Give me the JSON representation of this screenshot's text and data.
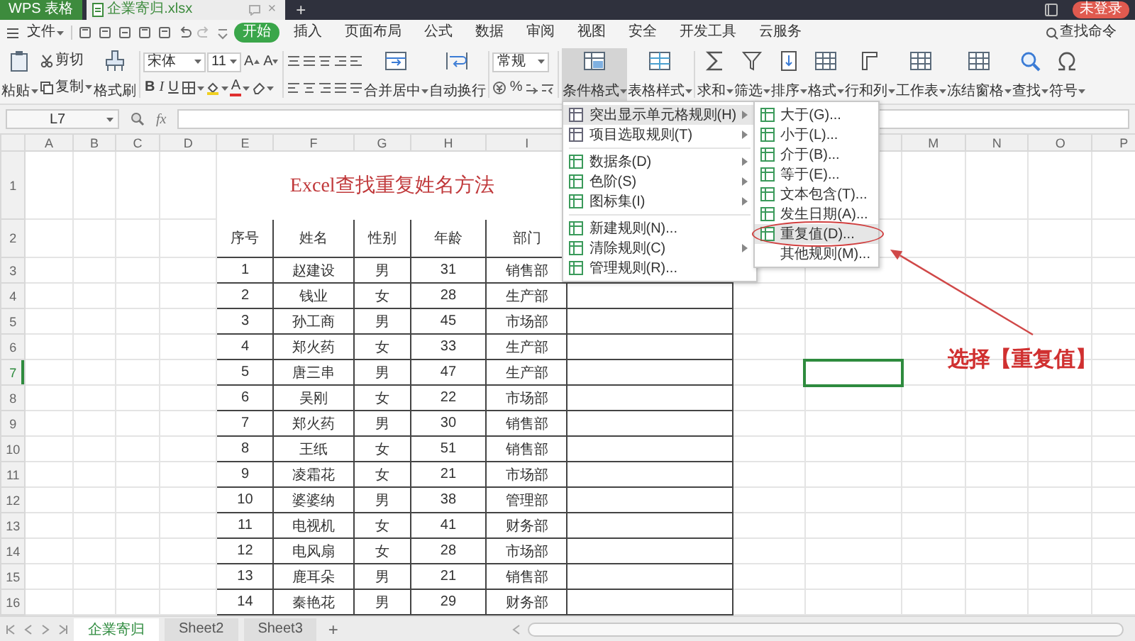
{
  "title_bar": {
    "app": "WPS 表格",
    "file_tab": "企業寄归.xlsx",
    "close": "×",
    "new_tab": "+",
    "account": "未登录"
  },
  "menu_bar": {
    "file": "文件",
    "tabs": [
      {
        "label": "开始",
        "selected": true
      },
      {
        "label": "插入",
        "selected": false
      },
      {
        "label": "页面布局",
        "selected": false
      },
      {
        "label": "公式",
        "selected": false
      },
      {
        "label": "数据",
        "selected": false
      },
      {
        "label": "审阅",
        "selected": false
      },
      {
        "label": "视图",
        "selected": false
      },
      {
        "label": "安全",
        "selected": false
      },
      {
        "label": "开发工具",
        "selected": false
      },
      {
        "label": "云服务",
        "selected": false
      }
    ],
    "search": "查找命令"
  },
  "ribbon": {
    "clipboard": {
      "paste": {
        "label": "粘贴",
        "dropdown": true
      },
      "cut": {
        "label": "剪切"
      },
      "copy": {
        "label": "复制",
        "dropdown": true
      },
      "format_painter": {
        "label": "格式刷"
      }
    },
    "font": {
      "family": "宋体",
      "size": "11",
      "grow": "A",
      "shrink": "A",
      "bold": "B",
      "italic": "I",
      "underline": "U",
      "font_color": "A"
    },
    "alignment": {
      "merge": {
        "label": "合并居中",
        "dropdown": true
      },
      "wrap": {
        "label": "自动换行"
      }
    },
    "number": {
      "format": "常规",
      "percent": "%"
    },
    "buttons": [
      {
        "label": "条件格式",
        "dropdown": true,
        "pressed": true
      },
      {
        "label": "表格样式",
        "dropdown": true,
        "pressed": false
      },
      {
        "label": "求和",
        "dropdown": true,
        "pressed": false
      },
      {
        "label": "筛选",
        "dropdown": true,
        "pressed": false
      },
      {
        "label": "排序",
        "dropdown": true,
        "pressed": false
      },
      {
        "label": "格式",
        "dropdown": true,
        "pressed": false
      },
      {
        "label": "行和列",
        "dropdown": true,
        "pressed": false
      },
      {
        "label": "工作表",
        "dropdown": true,
        "pressed": false
      },
      {
        "label": "冻结窗格",
        "dropdown": true,
        "pressed": false
      },
      {
        "label": "查找",
        "dropdown": true,
        "pressed": false
      },
      {
        "label": "符号",
        "dropdown": true,
        "pressed": false
      }
    ]
  },
  "formula_bar": {
    "name_box": "L7",
    "function_label": "fx"
  },
  "sheet": {
    "columns_left": [
      "A",
      "B",
      "C",
      "D",
      "E",
      "F",
      "G",
      "H",
      "I"
    ],
    "columns_right": [
      "M",
      "N",
      "O",
      "P"
    ],
    "title": "Excel查找重复姓名方法",
    "headers": [
      "序号",
      "姓名",
      "性别",
      "年龄",
      "部门"
    ],
    "rows": [
      {
        "label": "1",
        "selected": false
      },
      {
        "label": "2",
        "selected": false
      },
      {
        "label": "3",
        "selected": false
      },
      {
        "label": "4",
        "selected": false
      },
      {
        "label": "5",
        "selected": false
      },
      {
        "label": "6",
        "selected": false
      },
      {
        "label": "7",
        "selected": true
      },
      {
        "label": "8",
        "selected": false
      },
      {
        "label": "9",
        "selected": false
      },
      {
        "label": "10",
        "selected": false
      },
      {
        "label": "11",
        "selected": false
      },
      {
        "label": "12",
        "selected": false
      },
      {
        "label": "13",
        "selected": false
      },
      {
        "label": "14",
        "selected": false
      },
      {
        "label": "15",
        "selected": false
      },
      {
        "label": "16",
        "selected": false
      }
    ],
    "records": [
      [
        "1",
        "赵建设",
        "男",
        "31",
        "销售部"
      ],
      [
        "2",
        "钱业",
        "女",
        "28",
        "生产部"
      ],
      [
        "3",
        "孙工商",
        "男",
        "45",
        "市场部"
      ],
      [
        "4",
        "郑火药",
        "女",
        "33",
        "生产部"
      ],
      [
        "5",
        "唐三串",
        "男",
        "47",
        "生产部"
      ],
      [
        "6",
        "吴刚",
        "女",
        "22",
        "市场部"
      ],
      [
        "7",
        "郑火药",
        "男",
        "30",
        "销售部"
      ],
      [
        "8",
        "王纸",
        "女",
        "51",
        "销售部"
      ],
      [
        "9",
        "凌霜花",
        "女",
        "21",
        "市场部"
      ],
      [
        "10",
        "婆婆纳",
        "男",
        "38",
        "管理部"
      ],
      [
        "11",
        "电视机",
        "女",
        "41",
        "财务部"
      ],
      [
        "12",
        "电风扇",
        "女",
        "28",
        "市场部"
      ],
      [
        "13",
        "鹿耳朵",
        "男",
        "21",
        "销售部"
      ],
      [
        "14",
        "秦艳花",
        "男",
        "29",
        "财务部"
      ]
    ]
  },
  "sheet_tabs": {
    "tabs": [
      {
        "label": "企業寄归",
        "selected": true
      },
      {
        "label": "Sheet2",
        "selected": false
      },
      {
        "label": "Sheet3",
        "selected": false
      }
    ],
    "add": "+"
  },
  "menu": {
    "groups": [
      {
        "items": [
          {
            "label": "突出显示单元格规则(H)",
            "submenu": true,
            "selected": true
          },
          {
            "label": "项目选取规则(T)",
            "submenu": true,
            "selected": false
          }
        ]
      },
      {
        "items": [
          {
            "label": "数据条(D)",
            "submenu": true,
            "selected": false
          },
          {
            "label": "色阶(S)",
            "submenu": true,
            "selected": false
          },
          {
            "label": "图标集(I)",
            "submenu": true,
            "selected": false
          }
        ]
      },
      {
        "items": [
          {
            "label": "新建规则(N)...",
            "submenu": false,
            "selected": false
          },
          {
            "label": "清除规则(C)",
            "submenu": true,
            "selected": false
          },
          {
            "label": "管理规则(R)...",
            "submenu": false,
            "selected": false
          }
        ]
      }
    ]
  },
  "submenu": {
    "items": [
      {
        "label": "大于(G)...",
        "icon": true,
        "selected": false,
        "circled": false
      },
      {
        "label": "小于(L)...",
        "icon": true,
        "selected": false,
        "circled": false
      },
      {
        "label": "介于(B)...",
        "icon": true,
        "selected": false,
        "circled": false
      },
      {
        "label": "等于(E)...",
        "icon": true,
        "selected": false,
        "circled": false
      },
      {
        "label": "文本包含(T)...",
        "icon": true,
        "selected": false,
        "circled": false
      },
      {
        "label": "发生日期(A)...",
        "icon": true,
        "selected": false,
        "circled": false
      },
      {
        "label": "重复值(D)...",
        "icon": true,
        "selected": true,
        "circled": true
      },
      {
        "label": "其他规则(M)...",
        "icon": false,
        "selected": false,
        "circled": false
      }
    ]
  },
  "annotation": {
    "text": "选择【重复值】"
  }
}
